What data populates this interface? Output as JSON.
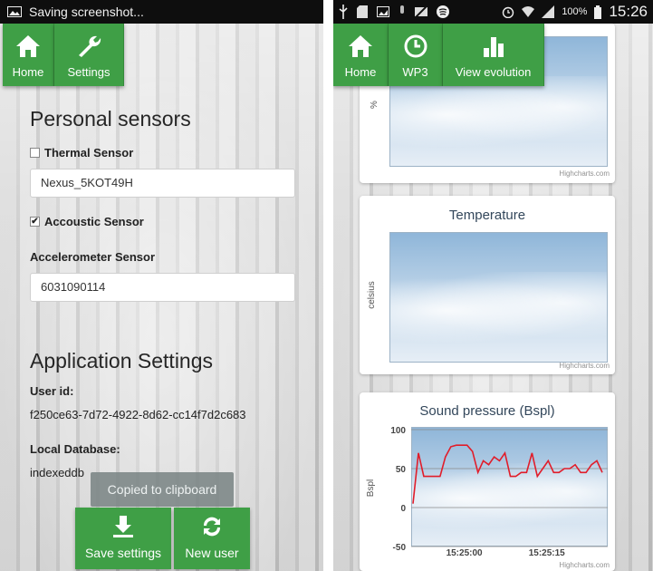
{
  "left_screen": {
    "status_bar": {
      "text": "Saving screenshot..."
    },
    "nav": {
      "home_label": "Home",
      "settings_label": "Settings"
    },
    "personal": {
      "title": "Personal sensors",
      "thermal_label": "Thermal Sensor",
      "thermal_checked": false,
      "thermal_value": "Nexus_5KOT49H",
      "acoustic_label": "Accoustic Sensor",
      "acoustic_checked": true,
      "accelerometer_label": "Accelerometer Sensor",
      "accelerometer_value": "6031090114"
    },
    "app_settings": {
      "title": "Application Settings",
      "user_id_label": "User id:",
      "user_id_value": "f250ce63-7d72-4922-8d62-cc14f7d2c683",
      "local_db_label": "Local Database:",
      "local_db_value": "indexeddb"
    },
    "toast": "Copied to clipboard",
    "buttons": {
      "save_label": "Save settings",
      "new_user_label": "New user"
    }
  },
  "right_screen": {
    "status_bar": {
      "battery": "100%",
      "time": "15:26"
    },
    "nav": {
      "home_label": "Home",
      "wp3_label": "WP3",
      "evolution_label": "View evolution"
    },
    "chart1": {
      "ylabel": "%",
      "credit": "Highcharts.com"
    },
    "chart2": {
      "title": "Temperature",
      "ylabel": "celsius",
      "credit": "Highcharts.com"
    },
    "chart3": {
      "credit": "Highcharts.com"
    }
  },
  "chart_data": {
    "type": "line",
    "title": "Sound pressure (Bspl)",
    "ylabel": "Bspl",
    "ylim": [
      -50,
      100
    ],
    "yticks": [
      "100",
      "50",
      "0",
      "-50"
    ],
    "xticks": [
      "15:25:00",
      "15:25:15"
    ],
    "series": [
      {
        "color": "#e11d2a",
        "values": [
          5,
          70,
          40,
          40,
          40,
          40,
          65,
          78,
          80,
          80,
          80,
          72,
          45,
          60,
          55,
          65,
          60,
          70,
          40,
          40,
          45,
          45,
          70,
          40,
          50,
          60,
          45,
          45,
          50,
          50,
          55,
          45,
          45,
          55,
          60,
          45
        ]
      }
    ],
    "grid": true,
    "colors": {
      "accent": "#3f9f46"
    }
  }
}
